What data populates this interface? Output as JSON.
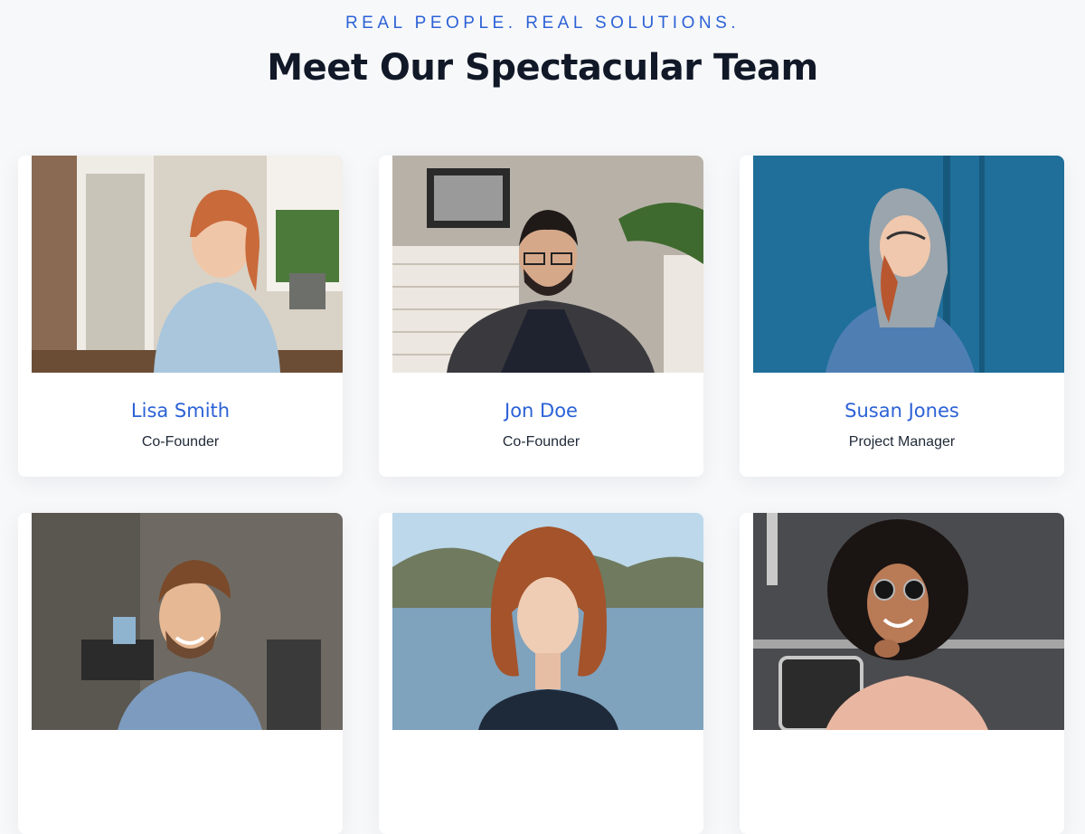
{
  "header": {
    "eyebrow": "REAL PEOPLE. REAL SOLUTIONS.",
    "title": "Meet Our Spectacular Team"
  },
  "team": [
    {
      "name": "Lisa Smith",
      "role": "Co-Founder",
      "photo": "photo-woman-smiling-office"
    },
    {
      "name": "Jon Doe",
      "role": "Co-Founder",
      "photo": "photo-man-glasses-brick-wall"
    },
    {
      "name": "Susan Jones",
      "role": "Project Manager",
      "photo": "photo-woman-hoodie-blue-wall"
    },
    {
      "name": "",
      "role": "",
      "photo": "photo-man-smiling-office"
    },
    {
      "name": "",
      "role": "",
      "photo": "photo-woman-lake-portrait"
    },
    {
      "name": "",
      "role": "",
      "photo": "photo-woman-sunglasses-curly-hair"
    }
  ],
  "colors": {
    "accent": "#2c62d6",
    "heading": "#111827",
    "background": "#f7f8fa"
  }
}
